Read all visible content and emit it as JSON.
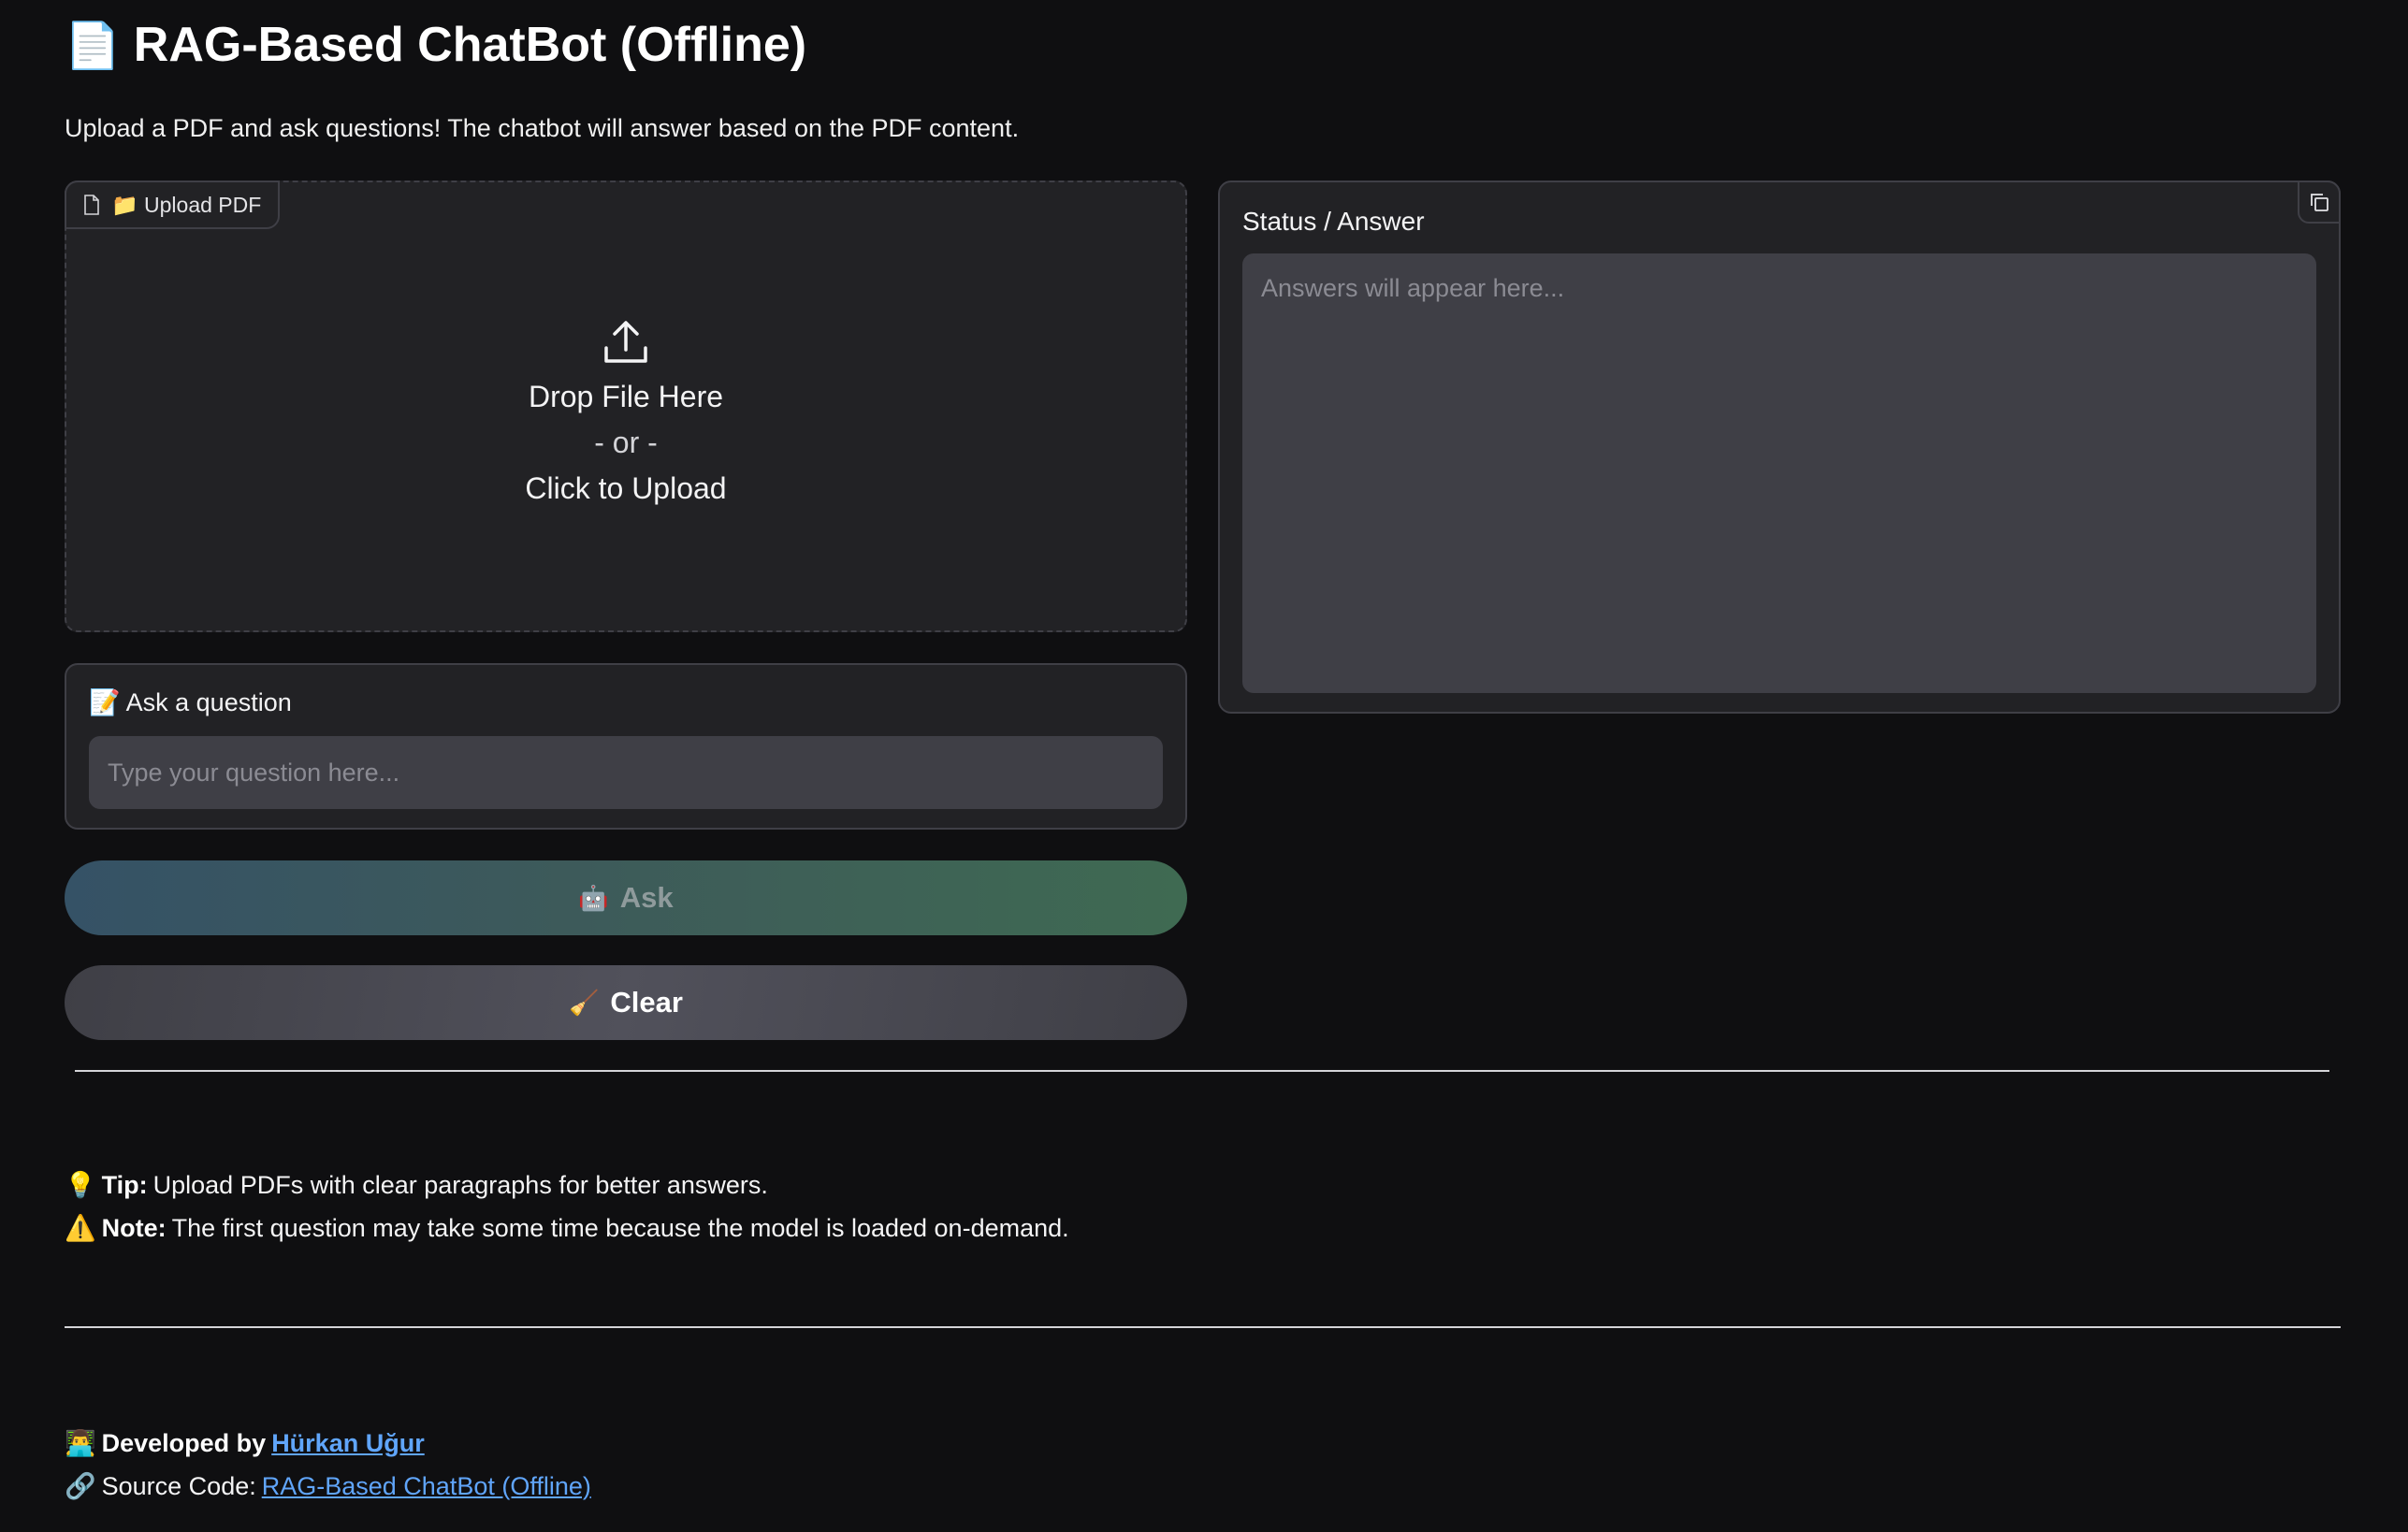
{
  "header": {
    "title_emoji": "📄",
    "title": "RAG-Based ChatBot (Offline)",
    "subtitle": "Upload a PDF and ask questions! The chatbot will answer based on the PDF content."
  },
  "upload": {
    "tab_label": "📁 Upload PDF",
    "drop_text": "Drop File Here",
    "or_text": "- or -",
    "click_text": "Click to Upload"
  },
  "question": {
    "label": "📝 Ask a question",
    "placeholder": "Type your question here..."
  },
  "buttons": {
    "ask_icon": "🤖",
    "ask_label": "Ask",
    "clear_icon": "🧹",
    "clear_label": "Clear"
  },
  "status": {
    "label": "Status / Answer",
    "placeholder": "Answers will appear here..."
  },
  "tips": {
    "tip_icon": "💡",
    "tip_bold": "Tip:",
    "tip_text": "Upload PDFs with clear paragraphs for better answers.",
    "note_icon": "⚠️",
    "note_bold": "Note:",
    "note_text": "The first question may take some time because the model is loaded on-demand."
  },
  "footer": {
    "dev_icon": "👨‍💻",
    "dev_prefix": "Developed by",
    "dev_name": "Hürkan Uğur",
    "source_icon": "🔗",
    "source_prefix": "Source Code:",
    "source_link": "RAG-Based ChatBot (Offline)"
  },
  "colors": {
    "background": "#0f0f11",
    "panel": "#222225",
    "input": "#3f3f46",
    "link": "#60a5fa"
  }
}
